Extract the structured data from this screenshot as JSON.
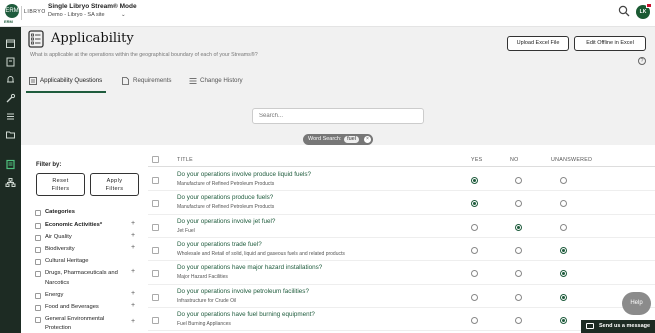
{
  "app": {
    "logo_text": "ERM",
    "logo_sub": "ERM",
    "brand": "LIBRYO",
    "mode_title": "Single Libryo Stream® Mode",
    "site_select": "Demo - Libryo - SA site",
    "user_initials": "LK"
  },
  "header": {
    "title": "Applicability",
    "description": "What is applicable at the operations within the geographical boundary of each of your Streams®?",
    "upload_button": "Upload Excel File",
    "edit_offline_button": "Edit Offline in Excel",
    "help_symbol": "?"
  },
  "tabs": [
    {
      "label": "Applicability Questions",
      "active": true
    },
    {
      "label": "Requirements",
      "active": false
    },
    {
      "label": "Change History",
      "active": false
    }
  ],
  "search": {
    "placeholder": "Search...",
    "word_search_label": "Word Search:",
    "word_search_value": "fuel",
    "clear_symbol": "×"
  },
  "filters": {
    "label": "Filter by:",
    "reset_line1": "Reset",
    "reset_line2": "Filters",
    "apply_line1": "Apply",
    "apply_line2": "Filters",
    "categories_label": "Categories",
    "items": [
      {
        "label": "Economic Activities*",
        "expandable": true
      },
      {
        "label": "Air Quality",
        "expandable": true
      },
      {
        "label": "Biodiversity",
        "expandable": true
      },
      {
        "label": "Cultural Heritage",
        "expandable": false
      },
      {
        "label": "Drugs, Pharmaceuticals and",
        "label2": "Narcotics",
        "expandable": true
      },
      {
        "label": "Energy",
        "expandable": true
      },
      {
        "label": "Food and Beverages",
        "expandable": true
      },
      {
        "label": "General Environmental",
        "label2": "Protection",
        "expandable": true
      }
    ]
  },
  "table": {
    "columns": [
      "TITLE",
      "YES",
      "NO",
      "UNANSWERED"
    ],
    "rows": [
      {
        "title": "Do your operations involve produce liquid fuels?",
        "subtitle": "Manufacture of Refined Petroleum Products",
        "answer": "yes"
      },
      {
        "title": "Do your operations produce fuels?",
        "subtitle": "Manufacture of Refined Petroleum Products",
        "answer": "yes"
      },
      {
        "title": "Do your operations involve jet fuel?",
        "subtitle": "Jet Fuel",
        "answer": "no"
      },
      {
        "title": "Do your operations trade fuel?",
        "subtitle": "Wholesale and Retail of solid, liquid and gaseous fuels and related products",
        "answer": "unanswered"
      },
      {
        "title": "Do your operations have major hazard installations?",
        "subtitle": "Major Hazard Facilities",
        "answer": "unanswered"
      },
      {
        "title": "Do your operations involve petroleum facilities?",
        "subtitle": "Infrastructure for Crude Oil",
        "answer": "unanswered"
      },
      {
        "title": "Do your operations have fuel burning equipment?",
        "subtitle": "Fuel Burning Appliances",
        "answer": "unanswered"
      }
    ]
  },
  "widgets": {
    "help_label": "Help",
    "message_label": "Send us a message"
  },
  "colors": {
    "brand_green": "#1f5c3d",
    "sidebar_bg": "#1d2b23",
    "header_bg": "#f1f1f1"
  }
}
